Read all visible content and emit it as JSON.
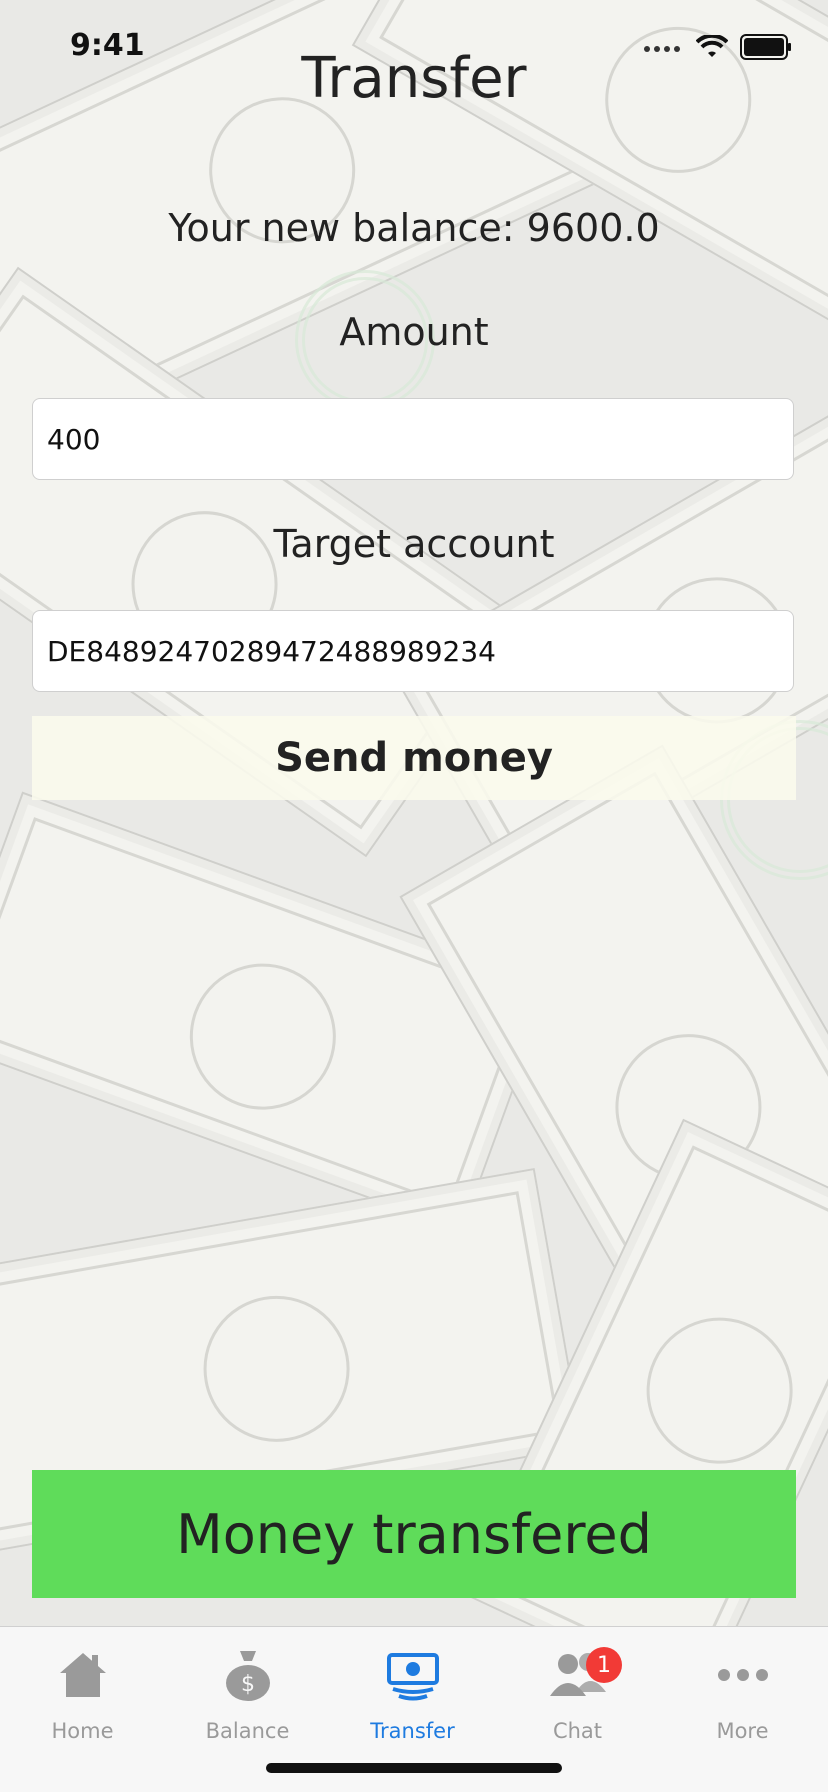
{
  "status_bar": {
    "time": "9:41"
  },
  "header": {
    "title": "Transfer"
  },
  "balance_text": "Your new balance: 9600.0",
  "form": {
    "amount_label": "Amount",
    "amount_value": "400",
    "target_label": "Target account",
    "target_value": "DE84892470289472488989234",
    "send_label": "Send money"
  },
  "toast": {
    "message": "Money transfered"
  },
  "tabbar": {
    "items": [
      {
        "label": "Home",
        "icon": "house-icon",
        "active": false
      },
      {
        "label": "Balance",
        "icon": "money-bag-icon",
        "active": false
      },
      {
        "label": "Transfer",
        "icon": "banknote-icon",
        "active": true
      },
      {
        "label": "Chat",
        "icon": "people-icon",
        "active": false,
        "badge": "1"
      },
      {
        "label": "More",
        "icon": "ellipsis-icon",
        "active": false
      }
    ],
    "active_color": "#1e7be0",
    "inactive_color": "#9a9a9a"
  },
  "colors": {
    "toast_bg": "#5fdc5a",
    "badge": "#f23a36"
  }
}
